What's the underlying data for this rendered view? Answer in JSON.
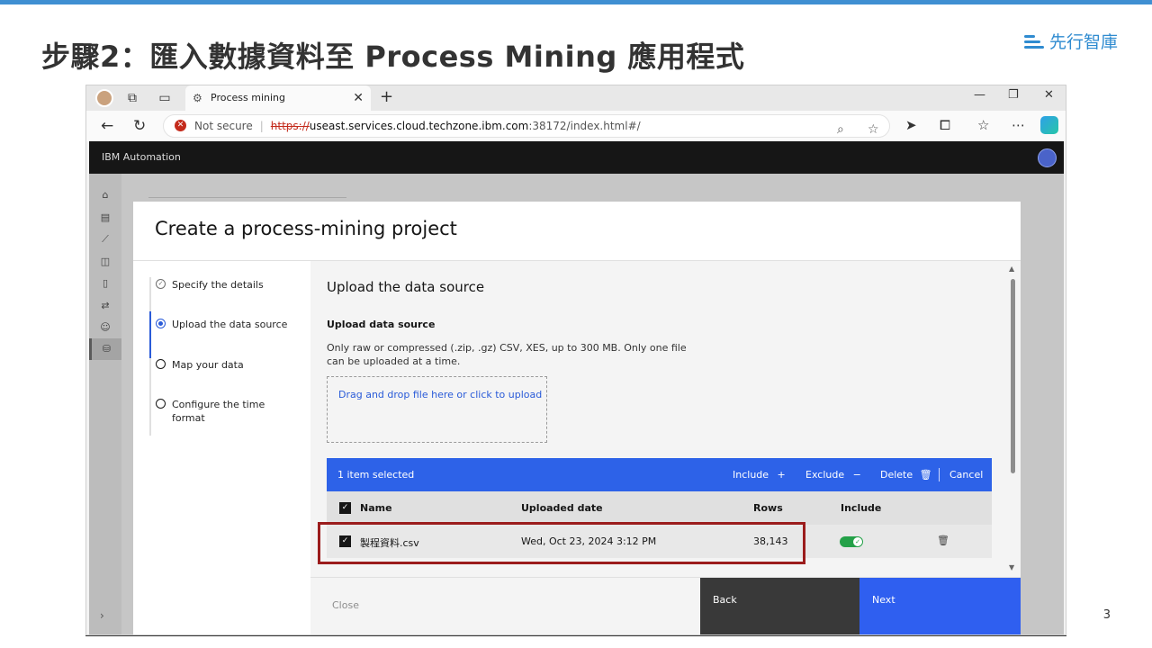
{
  "slide": {
    "title": "步驟2：匯入數據資料至 Process Mining 應用程式",
    "brand": "先行智庫",
    "page_number": "3"
  },
  "browser": {
    "tab_title": "Process mining",
    "security_label": "Not secure",
    "url_scheme": "https://",
    "url_host": "useast.services.cloud.techzone.ibm.com",
    "url_rest": ":38172/index.html#/"
  },
  "app": {
    "product_name": "IBM Automation"
  },
  "modal": {
    "title": "Create a process-mining project",
    "steps": [
      {
        "label": "Specify the details",
        "state": "complete"
      },
      {
        "label": "Upload the data source",
        "state": "current"
      },
      {
        "label": "Map your data",
        "state": "incomplete"
      },
      {
        "label": "Configure the time format",
        "state": "incomplete"
      }
    ],
    "section_title": "Upload the data source",
    "upload_label": "Upload data source",
    "upload_help": "Only raw or compressed (.zip, .gz) CSV, XES, up to 300 MB. Only one file can be uploaded at a time.",
    "dropzone_text": "Drag and drop file here or click to upload",
    "batch": {
      "selected": "1 item selected",
      "include": "Include",
      "exclude": "Exclude",
      "delete": "Delete",
      "cancel": "Cancel"
    },
    "table": {
      "headers": [
        "Name",
        "Uploaded date",
        "Rows",
        "Include"
      ],
      "rows": [
        {
          "name": "製程資料.csv",
          "uploaded": "Wed, Oct 23, 2024 3:12 PM",
          "rows": "38,143",
          "include": true
        }
      ]
    },
    "footer": {
      "close": "Close",
      "back": "Back",
      "next": "Next"
    }
  },
  "colors": {
    "accent": "#2d62e8",
    "highlight": "#9b1c1c",
    "toggle_on": "#24a148"
  }
}
